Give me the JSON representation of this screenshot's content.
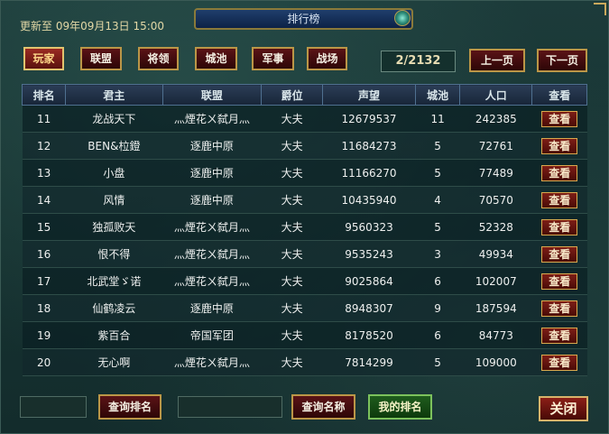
{
  "header": {
    "update_time": "更新至 09年09月13日 15:00",
    "title": "排行榜"
  },
  "tabs": [
    {
      "label": "玩家",
      "active": true
    },
    {
      "label": "联盟",
      "active": false
    },
    {
      "label": "将领",
      "active": false
    },
    {
      "label": "城池",
      "active": false
    },
    {
      "label": "军事",
      "active": false
    },
    {
      "label": "战场",
      "active": false
    }
  ],
  "pagination": {
    "page_display": "2/2132",
    "prev_label": "上一页",
    "next_label": "下一页"
  },
  "table": {
    "columns": [
      "排名",
      "君主",
      "联盟",
      "爵位",
      "声望",
      "城池",
      "人口",
      "查看"
    ],
    "view_label": "查看",
    "rows": [
      {
        "rank": "11",
        "lord": "龙战天下",
        "alliance": "灬煙花ㄨ弑月灬",
        "title": "大夫",
        "prestige": "12679537",
        "cities": "11",
        "population": "242385"
      },
      {
        "rank": "12",
        "lord": "BEN&柆鐙",
        "alliance": "逐鹿中原",
        "title": "大夫",
        "prestige": "11684273",
        "cities": "5",
        "population": "72761"
      },
      {
        "rank": "13",
        "lord": "小盘",
        "alliance": "逐鹿中原",
        "title": "大夫",
        "prestige": "11166270",
        "cities": "5",
        "population": "77489"
      },
      {
        "rank": "14",
        "lord": "风情",
        "alliance": "逐鹿中原",
        "title": "大夫",
        "prestige": "10435940",
        "cities": "4",
        "population": "70570"
      },
      {
        "rank": "15",
        "lord": "独孤败天",
        "alliance": "灬煙花ㄨ弑月灬",
        "title": "大夫",
        "prestige": "9560323",
        "cities": "5",
        "population": "52328"
      },
      {
        "rank": "16",
        "lord": "恨不得",
        "alliance": "灬煙花ㄨ弑月灬",
        "title": "大夫",
        "prestige": "9535243",
        "cities": "3",
        "population": "49934"
      },
      {
        "rank": "17",
        "lord": "北武堂ゞ诺",
        "alliance": "灬煙花ㄨ弑月灬",
        "title": "大夫",
        "prestige": "9025864",
        "cities": "6",
        "population": "102007"
      },
      {
        "rank": "18",
        "lord": "仙鹤凌云",
        "alliance": "逐鹿中原",
        "title": "大夫",
        "prestige": "8948307",
        "cities": "9",
        "population": "187594"
      },
      {
        "rank": "19",
        "lord": "紫百合",
        "alliance": "帝国军团",
        "title": "大夫",
        "prestige": "8178520",
        "cities": "6",
        "population": "84773"
      },
      {
        "rank": "20",
        "lord": "无心啊",
        "alliance": "灬煙花ㄨ弑月灬",
        "title": "大夫",
        "prestige": "7814299",
        "cities": "5",
        "population": "109000"
      }
    ]
  },
  "footer": {
    "query_rank_label": "查询排名",
    "query_name_label": "查询名称",
    "my_rank_label": "我的排名",
    "close_label": "关闭"
  },
  "colors": {
    "tab_border": "#bb9647",
    "button_red": "#5a1316",
    "button_green": "#1f5c1d",
    "title_blue": "#1f3e6c"
  }
}
